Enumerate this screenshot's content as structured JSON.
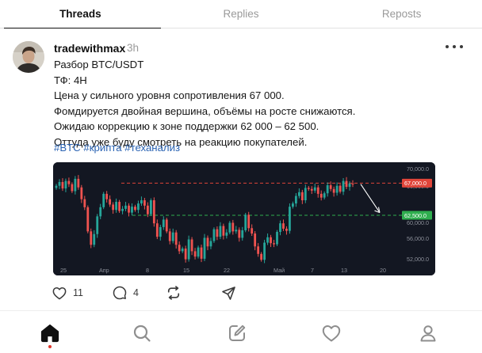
{
  "tabs": [
    {
      "label": "Threads",
      "active": true
    },
    {
      "label": "Replies",
      "active": false
    },
    {
      "label": "Reposts",
      "active": false
    }
  ],
  "post": {
    "author": "tradewithmax",
    "time": "3h",
    "lines": [
      "Разбор BTC/USDT",
      "ТФ: 4H",
      "Цена у сильного уровня сопротивления 67 000.",
      "Фомдируется двойная вершина, объёмы на росте снижаются.",
      "Ожидаю коррекцию к зоне поддержки 62 000 – 62 500.",
      "Оттуда уже буду смотреть на реакцию покупателей."
    ],
    "hashtags": [
      "#BTC",
      "#крипта",
      "#теханализ"
    ],
    "likes": "11",
    "comments": "4"
  },
  "chart_data": {
    "type": "candlestick",
    "pair": "BTC/USDT",
    "timeframe": "4H",
    "y_ticks": [
      "70,000.0",
      "66,000.0",
      "62,000.0",
      "60,000.0",
      "56,000.0",
      "52,000.0"
    ],
    "ylim": [
      52000,
      70000
    ],
    "x_ticks": [
      "25",
      "Апр",
      "8",
      "15",
      "22",
      "Май",
      "7",
      "13",
      "20"
    ],
    "resistance": {
      "value": 67000,
      "label": "67,000.0",
      "color": "#e0453a"
    },
    "support": {
      "value": 61000,
      "label": "62,500.0",
      "color": "#2fae4f"
    },
    "projection_arrow": {
      "from_price": 66800,
      "to_price": 61500,
      "color": "#ffffff"
    },
    "colors": {
      "up": "#26a69a",
      "down": "#ef5350",
      "background": "#131722",
      "axis_text": "#8b8f99"
    },
    "close_path": [
      66500,
      67200,
      66000,
      67400,
      66800,
      65500,
      67800,
      66200,
      64000,
      62500,
      58000,
      55500,
      57500,
      60800,
      62500,
      65000,
      64000,
      63000,
      62000,
      63500,
      61800,
      62200,
      62800,
      61500,
      62600,
      62000,
      63200,
      63800,
      62800,
      61200,
      63800,
      59500,
      57000,
      58800,
      60200,
      58000,
      56200,
      57800,
      55500,
      54300,
      54800,
      52800,
      56500,
      54300,
      53300,
      55000,
      52900,
      56800,
      55200,
      56200,
      58400,
      57000,
      59000,
      57200,
      57800,
      59600,
      58000,
      58300,
      56800,
      58200,
      61100,
      58600,
      57600,
      55200,
      53800,
      52700,
      55900,
      56900,
      55800,
      55600,
      57900,
      59500,
      58500,
      58100,
      62600,
      63200,
      64600,
      65300,
      63800,
      66100,
      65900,
      65600,
      66200,
      65000,
      64300,
      65100,
      66600,
      65900,
      65200,
      66500,
      65400,
      67400,
      66300,
      66900,
      66800
    ]
  },
  "nav": [
    "home-icon",
    "search-icon",
    "compose-icon",
    "activity-heart-icon",
    "profile-icon"
  ]
}
